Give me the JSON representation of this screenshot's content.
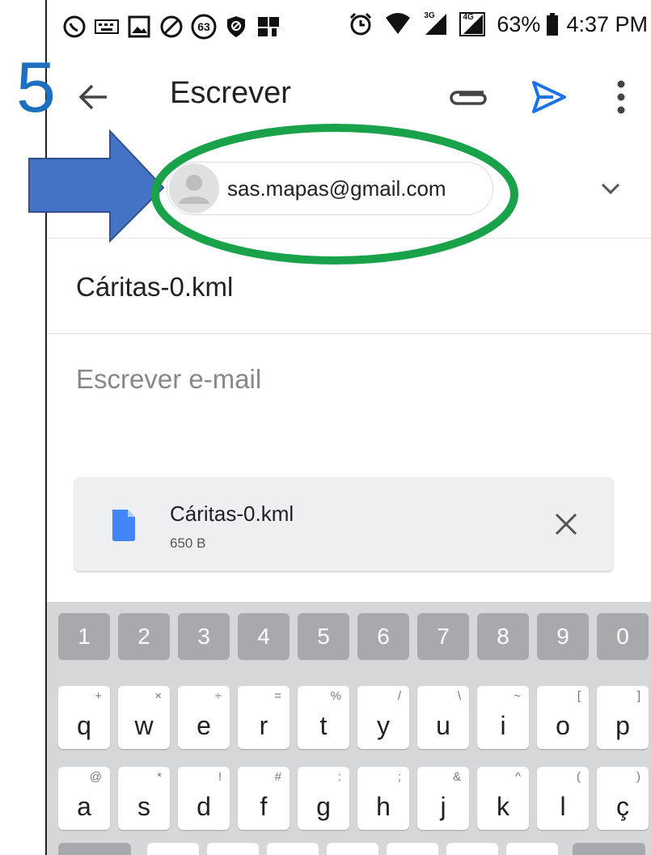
{
  "status_bar": {
    "battery_percent": "63%",
    "time": "4:37 PM",
    "notification_badge": "63",
    "net_3g": "3G",
    "net_4g": "4G"
  },
  "step_number": "5",
  "app_bar": {
    "title": "Escrever"
  },
  "from": {
    "email": "sas.mapas@gmail.com"
  },
  "subject": "Cáritas-0.kml",
  "body_placeholder": "Escrever e-mail",
  "attachment": {
    "name": "Cáritas-0.kml",
    "size": "650 B"
  },
  "keyboard": {
    "numbers": [
      "1",
      "2",
      "3",
      "4",
      "5",
      "6",
      "7",
      "8",
      "9",
      "0"
    ],
    "row1": [
      {
        "key": "q",
        "hint": "+"
      },
      {
        "key": "w",
        "hint": "×"
      },
      {
        "key": "e",
        "hint": "÷"
      },
      {
        "key": "r",
        "hint": "="
      },
      {
        "key": "t",
        "hint": "%"
      },
      {
        "key": "y",
        "hint": "/"
      },
      {
        "key": "u",
        "hint": "\\"
      },
      {
        "key": "i",
        "hint": "~"
      },
      {
        "key": "o",
        "hint": "["
      },
      {
        "key": "p",
        "hint": "]"
      }
    ],
    "row2": [
      {
        "key": "a",
        "hint": "@"
      },
      {
        "key": "s",
        "hint": "*"
      },
      {
        "key": "d",
        "hint": "!"
      },
      {
        "key": "f",
        "hint": "#"
      },
      {
        "key": "g",
        "hint": ":"
      },
      {
        "key": "h",
        "hint": ";"
      },
      {
        "key": "j",
        "hint": "&"
      },
      {
        "key": "k",
        "hint": "^"
      },
      {
        "key": "l",
        "hint": "("
      },
      {
        "key": "ç",
        "hint": ")"
      }
    ]
  },
  "colors": {
    "send": "#1a73e8",
    "annotation_ellipse": "#1aa24a",
    "annotation_arrow": "#4472c4",
    "step_number": "#1f6fc0",
    "file_icon": "#4285f4"
  }
}
